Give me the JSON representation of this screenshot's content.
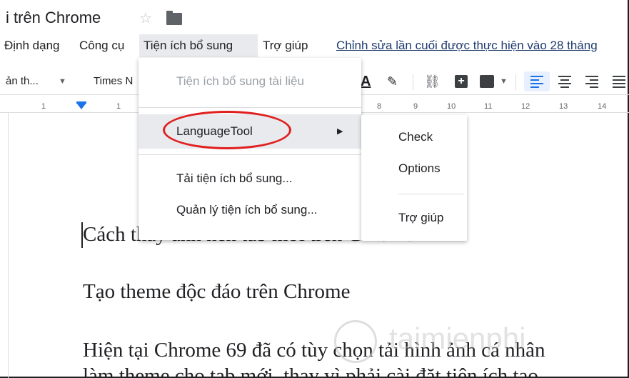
{
  "doc_title": "i trên Chrome",
  "menubar": {
    "format": "Định dạng",
    "tools": "Công cụ",
    "addons": "Tiện ích bổ sung",
    "help": "Trợ giúp",
    "last_edit": "Chỉnh sửa lần cuối được thực hiện vào 28 tháng"
  },
  "toolbar": {
    "style": "ản th...",
    "font": "Times N",
    "text_color_glyph": "A"
  },
  "ruler_numbers": [
    "1",
    "1",
    "8",
    "9",
    "10",
    "11",
    "12",
    "13",
    "14"
  ],
  "addons_menu": {
    "docs_addons": "Tiện ích bổ sung tài liệu",
    "languagetool": "LanguageTool",
    "get_addons": "Tải tiện ích bổ sung...",
    "manage_addons": "Quản lý tiện ích bổ sung..."
  },
  "languagetool_submenu": {
    "check": "Check",
    "options": "Options",
    "help": "Trợ giúp"
  },
  "document": {
    "para1": "Cách thay ảnh nền tab mới trên Chrome",
    "para2": "Tạo theme độc đáo trên Chrome",
    "para3": "Hiện tại Chrome 69 đã có tùy chọn tải hình ảnh cá nhân",
    "para4": "làm theme cho tab mới, thay vì phải cài đặt tiện ích tạo"
  },
  "watermark": "taimienphi",
  "colors": {
    "accent_blue": "#1a73e8",
    "annotation_red": "#e02020",
    "menu_highlight": "#e8eaed"
  }
}
